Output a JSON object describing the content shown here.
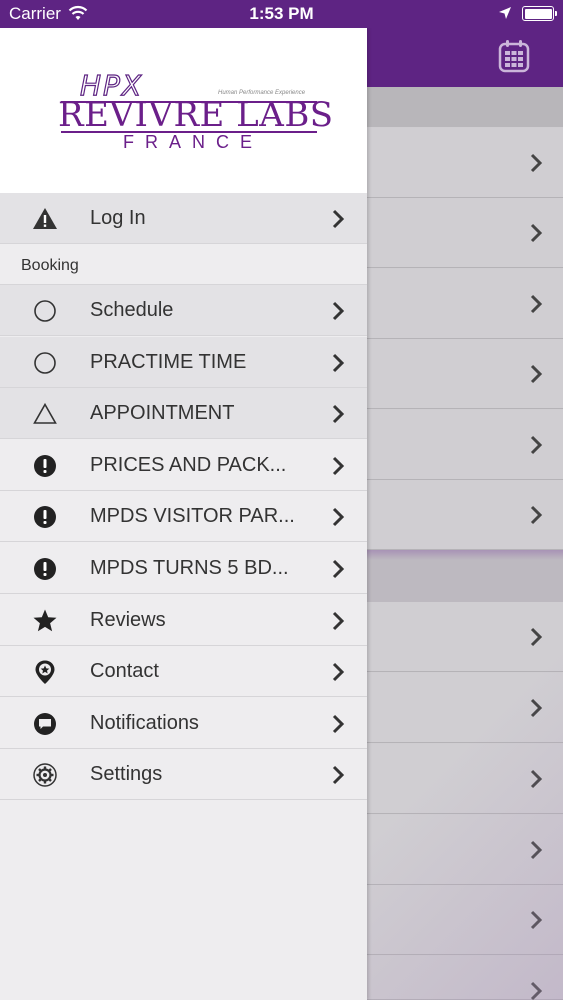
{
  "status_bar": {
    "carrier": "Carrier",
    "time": "1:53 PM",
    "wifi_icon": "wifi-icon",
    "location_icon": "location-arrow-icon",
    "battery_icon": "battery-full-icon"
  },
  "colors": {
    "brand_purple": "#5e2483",
    "logo_purple": "#6b1f8a",
    "drawer_bg": "#eeedef",
    "text": "#333333"
  },
  "logo": {
    "mark": "HPX",
    "tagline": "Human Performance Experience",
    "brand": "REVIVRE LABS",
    "country": "FRANCE"
  },
  "drawer": {
    "login": {
      "label": "Log In",
      "icon": "warning-triangle-icon"
    },
    "section_booking": "Booking",
    "items": [
      {
        "label": "Schedule",
        "icon": "circle-outline-icon",
        "shaded": true
      },
      {
        "label": "PRACTIME TIME",
        "icon": "circle-outline-icon",
        "shaded": true
      },
      {
        "label": "APPOINTMENT",
        "icon": "triangle-outline-icon",
        "shaded": true
      },
      {
        "label": "PRICES AND PACK...",
        "icon": "exclamation-circle-icon",
        "shaded": false
      },
      {
        "label": "MPDS VISITOR PAR...",
        "icon": "exclamation-circle-icon",
        "shaded": false
      },
      {
        "label": "MPDS TURNS 5 BD...",
        "icon": "exclamation-circle-icon",
        "shaded": false
      },
      {
        "label": "Reviews",
        "icon": "star-icon",
        "shaded": false
      },
      {
        "label": "Contact",
        "icon": "map-pin-star-icon",
        "shaded": false
      },
      {
        "label": "Notifications",
        "icon": "speech-bubble-icon",
        "shaded": false
      },
      {
        "label": "Settings",
        "icon": "gear-icon",
        "shaded": false
      }
    ]
  },
  "background_screen": {
    "calendar_icon": "calendar-icon",
    "chevron_icon": "chevron-right-icon"
  }
}
